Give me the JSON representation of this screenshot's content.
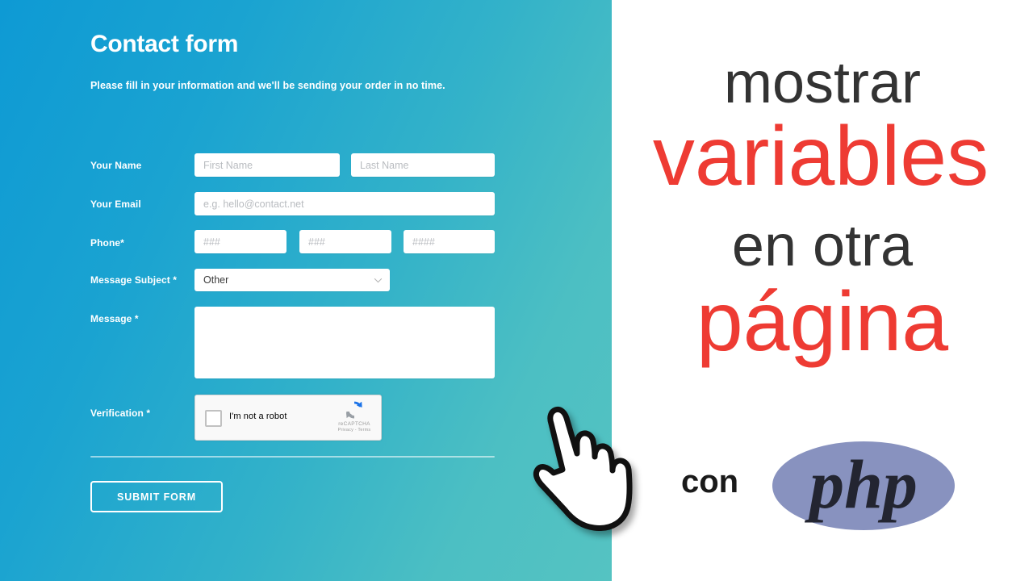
{
  "theme": {
    "gradient_start": "#0e9ad4",
    "gradient_end": "#55c3c2",
    "accent_red": "#ee3b33",
    "headline_dark": "#333333",
    "php_purple": "#8892bf",
    "php_text": "#232531"
  },
  "form": {
    "heading": "Contact form",
    "subheading": "Please fill in your information and we'll be sending your order in no time.",
    "fields": {
      "name": {
        "label": "Your Name",
        "first_placeholder": "First Name",
        "first_value": "",
        "last_placeholder": "Last Name",
        "last_value": ""
      },
      "email": {
        "label": "Your Email",
        "placeholder": "e.g. hello@contact.net",
        "value": ""
      },
      "phone": {
        "label": "Phone*",
        "placeholder_1": "###",
        "placeholder_2": "###",
        "placeholder_3": "####",
        "value_1": "",
        "value_2": "",
        "value_3": ""
      },
      "subject": {
        "label": "Message Subject *",
        "selected": "Other",
        "icon": "chevron-down-icon"
      },
      "message": {
        "label": "Message *",
        "placeholder": "",
        "value": ""
      },
      "verification": {
        "label": "Verification *",
        "checkbox_label": "I'm not a robot",
        "brand": "reCAPTCHA",
        "legal": "Privacy - Terms",
        "logo_icon": "recaptcha-logo-icon"
      }
    },
    "submit_label": "SUBMIT FORM"
  },
  "promo": {
    "line_1": "mostrar",
    "line_2": "variables",
    "line_3": "en otra",
    "line_4": "página",
    "con_label": "con",
    "php_logo_text": "php"
  },
  "cursor": {
    "icon": "hand-pointer-icon"
  }
}
